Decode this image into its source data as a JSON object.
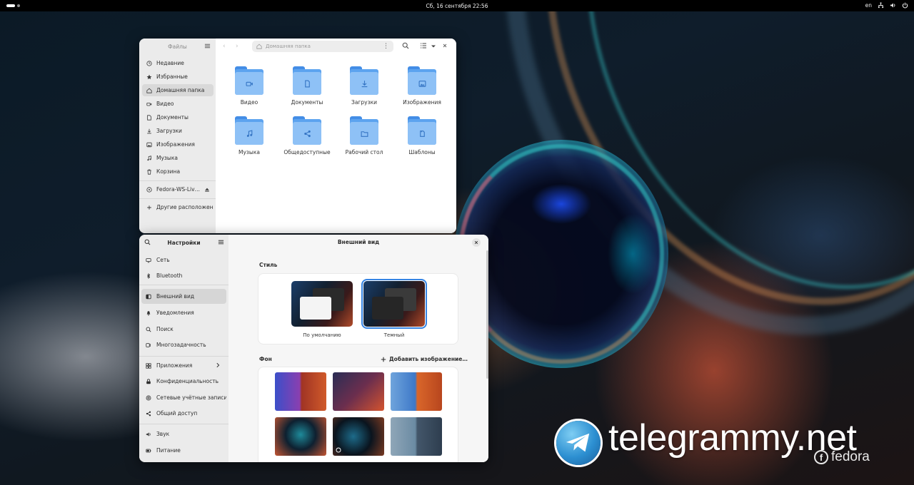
{
  "topbar": {
    "clock": "Сб, 16 сентября  22:56",
    "lang": "en",
    "icons": [
      "network-icon",
      "sound-icon",
      "power-icon"
    ]
  },
  "files": {
    "sidebar_title": "Файлы",
    "path": "Домашняя папка",
    "sidebar": [
      {
        "label": "Недавние",
        "icon": "clock-icon"
      },
      {
        "label": "Избранные",
        "icon": "star-icon"
      },
      {
        "label": "Домашняя папка",
        "icon": "home-icon"
      },
      {
        "label": "Видео",
        "icon": "video-icon"
      },
      {
        "label": "Документы",
        "icon": "document-icon"
      },
      {
        "label": "Загрузки",
        "icon": "download-icon"
      },
      {
        "label": "Изображения",
        "icon": "image-icon"
      },
      {
        "label": "Музыка",
        "icon": "music-icon"
      },
      {
        "label": "Корзина",
        "icon": "trash-icon"
      },
      {
        "label": "Fedora-WS-Liv…",
        "icon": "disc-icon"
      },
      {
        "label": "Другие расположения",
        "icon": "plus-icon"
      }
    ],
    "folders": [
      {
        "label": "Видео",
        "icon": "video-icon"
      },
      {
        "label": "Документы",
        "icon": "document-icon"
      },
      {
        "label": "Загрузки",
        "icon": "download-icon"
      },
      {
        "label": "Изображения",
        "icon": "image-icon"
      },
      {
        "label": "Музыка",
        "icon": "music-icon"
      },
      {
        "label": "Общедоступные",
        "icon": "share-icon"
      },
      {
        "label": "Рабочий стол",
        "icon": "desktop-folder-icon"
      },
      {
        "label": "Шаблоны",
        "icon": "template-icon"
      }
    ]
  },
  "settings": {
    "sidebar_title": "Настройки",
    "page_title": "Внешний вид",
    "sidebar": [
      {
        "label": "Сеть",
        "icon": "network-icon"
      },
      {
        "label": "Bluetooth",
        "icon": "bluetooth-icon"
      },
      {
        "label": "Внешний вид",
        "icon": "appearance-icon"
      },
      {
        "label": "Уведомления",
        "icon": "bell-icon"
      },
      {
        "label": "Поиск",
        "icon": "search-icon"
      },
      {
        "label": "Многозадачность",
        "icon": "multitask-icon"
      },
      {
        "label": "Приложения",
        "icon": "apps-icon"
      },
      {
        "label": "Конфиденциальность",
        "icon": "privacy-icon"
      },
      {
        "label": "Сетевые учётные записи",
        "icon": "accounts-icon"
      },
      {
        "label": "Общий доступ",
        "icon": "share-icon"
      },
      {
        "label": "Звук",
        "icon": "sound-icon"
      },
      {
        "label": "Питание",
        "icon": "power-icon"
      }
    ],
    "style_label": "Стиль",
    "style_options": [
      {
        "label": "По умолчанию",
        "selected": false
      },
      {
        "label": "Темный",
        "selected": true
      }
    ],
    "background_label": "Фон",
    "add_image": "Добавить изображение…"
  },
  "watermark": {
    "text": "telegrammy.net",
    "fedora": "fedora"
  },
  "colors": {
    "accent": "#3584e4",
    "folder": "#5ca3ef"
  }
}
